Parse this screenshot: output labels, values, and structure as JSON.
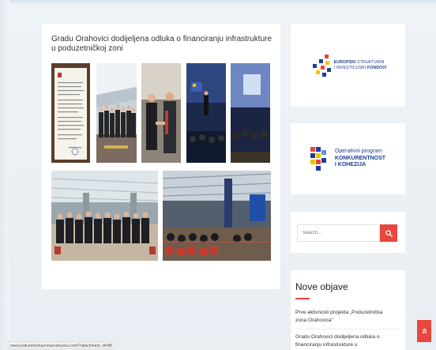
{
  "article": {
    "title": "Gradu Orahovici dodijeljena odluka o financiranju infrastrukture u poduzetničkoj zoni"
  },
  "gallery": [
    {
      "name": "document-photo",
      "theme": "document"
    },
    {
      "name": "group-photo-1",
      "theme": "group"
    },
    {
      "name": "handshake-photo",
      "theme": "handshake"
    },
    {
      "name": "speaker-photo-1",
      "theme": "speaker"
    },
    {
      "name": "speaker-photo-2",
      "theme": "speaker2"
    },
    {
      "name": "audience-photo-1",
      "theme": "hall"
    },
    {
      "name": "audience-photo-2",
      "theme": "hall2"
    }
  ],
  "sidebar": {
    "eu_logo": {
      "line1_bold": "EUROPSKI",
      "line1_thin": "STRUKTURNI",
      "line2_thin": "I INVESTICIJSKI",
      "line2_bold": "FONDOVI"
    },
    "op_logo": {
      "line1": "Operativni program",
      "line2": "KONKURENTNOST",
      "line3": "I KOHEZIJA"
    },
    "search": {
      "placeholder": "Search..."
    },
    "posts": {
      "title": "Nove objave",
      "items": [
        {
          "line1": "Prve aktivnosti projekta „Poduzetnička",
          "line2": "zona Orahovica\""
        },
        {
          "line1": "Gradu Orahovici dodijeljena odluka o",
          "line2": "financiranju infrastrukture u"
        }
      ]
    }
  },
  "status_bar": {
    "url": "www.poduzetnickazonaorahovica.com/?attachment_id=88"
  },
  "colors": {
    "accent": "#e8463e",
    "brand_blue": "#1c3f91"
  }
}
